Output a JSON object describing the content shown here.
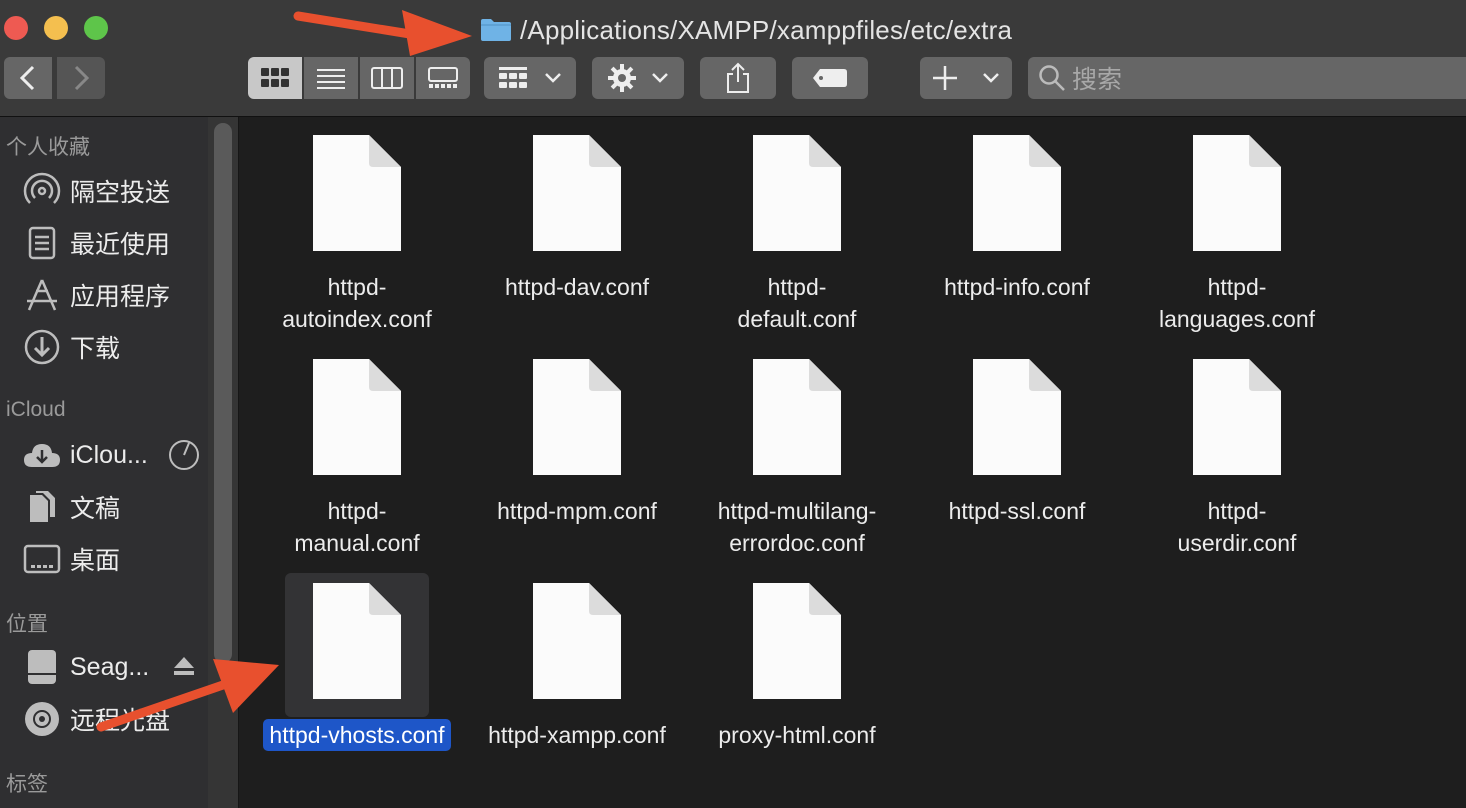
{
  "window": {
    "path": "/Applications/XAMPP/xamppfiles/etc/extra"
  },
  "toolbar": {
    "search_placeholder": "搜索"
  },
  "sidebar": {
    "favorites_header": "个人收藏",
    "favorites": [
      {
        "label": "隔空投送",
        "icon": "airdrop-icon"
      },
      {
        "label": "最近使用",
        "icon": "recents-icon"
      },
      {
        "label": "应用程序",
        "icon": "applications-icon"
      },
      {
        "label": "下载",
        "icon": "downloads-icon"
      }
    ],
    "icloud_header": "iCloud",
    "icloud": [
      {
        "label": "iClou...",
        "icon": "icloud-icon"
      },
      {
        "label": "文稿",
        "icon": "documents-icon"
      },
      {
        "label": "桌面",
        "icon": "desktop-icon"
      }
    ],
    "locations_header": "位置",
    "locations": [
      {
        "label": "Seag...",
        "icon": "drive-icon"
      },
      {
        "label": "远程光盘",
        "icon": "disc-icon"
      }
    ],
    "tags_header": "标签"
  },
  "files": [
    {
      "name": "httpd-\nautoindex.conf"
    },
    {
      "name": "httpd-dav.conf"
    },
    {
      "name": "httpd-\ndefault.conf"
    },
    {
      "name": "httpd-info.conf"
    },
    {
      "name": "httpd-\nlanguages.conf"
    },
    {
      "name": "httpd-\nmanual.conf"
    },
    {
      "name": "httpd-mpm.conf"
    },
    {
      "name": "httpd-multilang-\nerrordoc.conf"
    },
    {
      "name": "httpd-ssl.conf"
    },
    {
      "name": "httpd-\nuserdir.conf"
    },
    {
      "name": "httpd-vhosts.conf",
      "selected": true
    },
    {
      "name": "httpd-xampp.conf"
    },
    {
      "name": "proxy-html.conf"
    }
  ],
  "colors": {
    "selection": "#1e56c8",
    "annotation_arrow": "#e8502e",
    "folder": "#6fb3e6"
  }
}
